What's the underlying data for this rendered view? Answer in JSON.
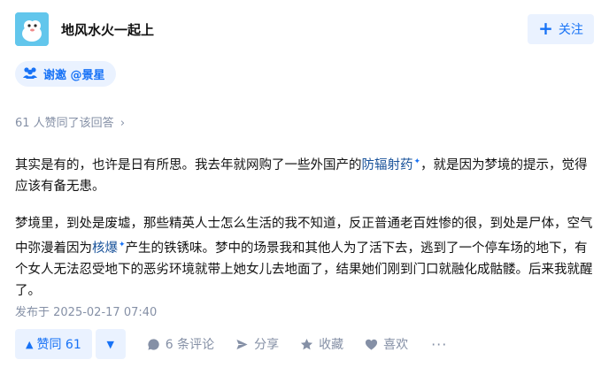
{
  "author": {
    "name": "地风水火一起上"
  },
  "follow_button": {
    "label": "关注"
  },
  "invite": {
    "label": "谢邀 @景星"
  },
  "votes_line": {
    "text": "61 人赞同了该回答"
  },
  "content": {
    "p1_part1": "其实是有的，也许是日有所思。我去年就网购了一些外国产的",
    "p1_link": "防辐射药",
    "p1_part2": "，就是因为梦境的提示，觉得应该有备无患。",
    "p2_part1": "梦境里，到处是废墟，那些精英人士怎么生活的我不知道，反正普通老百姓惨的很，到处是尸体，空气中弥漫着因为",
    "p2_link": "核爆",
    "p2_part2": "产生的铁锈味。梦中的场景我和其他人为了活下去，逃到了一个停车场的地下，有个女人无法忍受地下的恶劣环境就带上她女儿去地面了，结果她们刚到门口就融化成骷髅。后来我就醒了。"
  },
  "date": {
    "text": "发布于 2025-02-17 07:40"
  },
  "actions": {
    "upvote_label": "赞同 61",
    "comment_label": "6 条评论",
    "share_label": "分享",
    "collect_label": "收藏",
    "like_label": "喜欢",
    "more_label": "···"
  },
  "colors": {
    "brand_blue": "#1772f6",
    "light_blue_bg": "#eaf2ff",
    "gray_text": "#8590a6"
  }
}
